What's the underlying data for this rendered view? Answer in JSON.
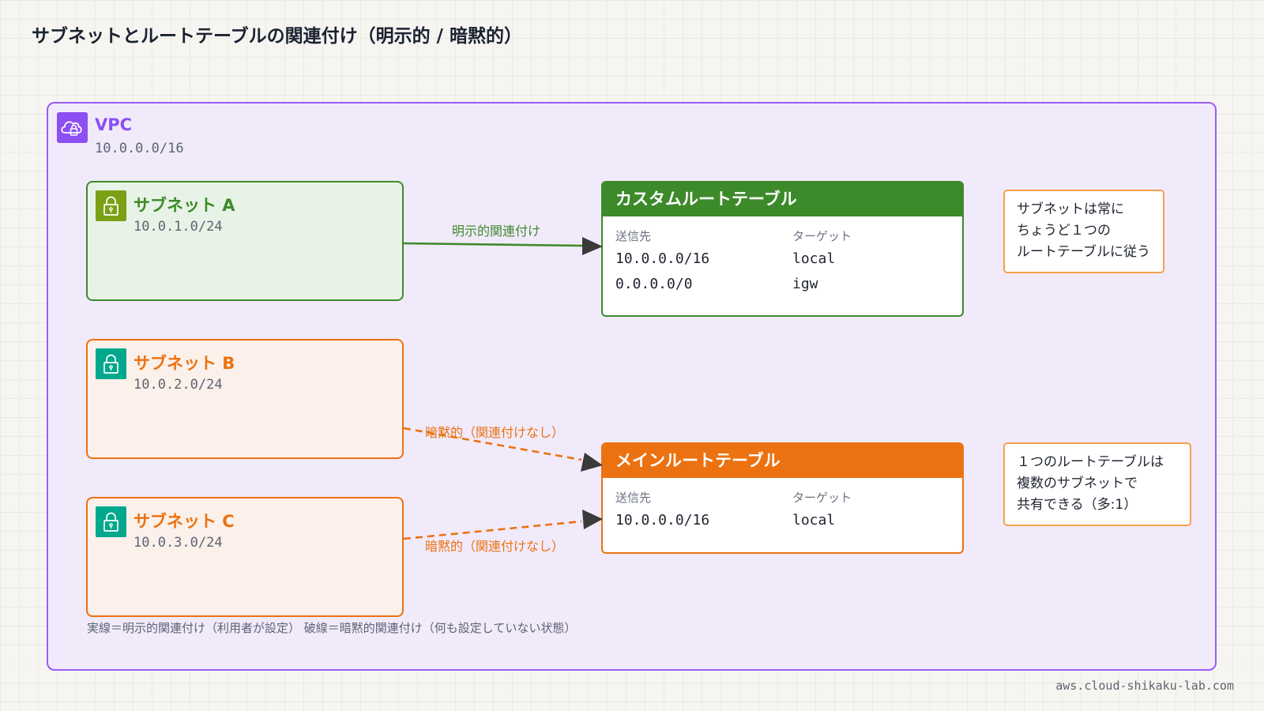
{
  "title": "サブネットとルートテーブルの関連付け（明示的 / 暗黙的）",
  "vpc": {
    "label": "VPC",
    "cidr": "10.0.0.0/16",
    "icon": "vpc-cloud-lock-icon",
    "color": "#8c4ff1"
  },
  "subnets": [
    {
      "name": "サブネット A",
      "cidr": "10.0.1.0/24",
      "icon": "lock-icon",
      "color": "#3d8a2a"
    },
    {
      "name": "サブネット B",
      "cidr": "10.0.2.0/24",
      "icon": "lock-icon",
      "color": "#ec7211"
    },
    {
      "name": "サブネット C",
      "cidr": "10.0.3.0/24",
      "icon": "lock-icon",
      "color": "#ec7211"
    }
  ],
  "route_tables": {
    "custom": {
      "title": "カスタムルートテーブル",
      "columns": [
        "送信先",
        "ターゲット"
      ],
      "routes": [
        {
          "dest": "10.0.0.0/16",
          "target": "local"
        },
        {
          "dest": "0.0.0.0/0",
          "target": "igw"
        }
      ]
    },
    "main": {
      "title": "メインルートテーブル",
      "columns": [
        "送信先",
        "ターゲット"
      ],
      "routes": [
        {
          "dest": "10.0.0.0/16",
          "target": "local"
        }
      ]
    }
  },
  "connections": {
    "explicit_label": "明示的関連付け",
    "implicit_label_b": "暗黙的（関連付けなし）",
    "implicit_label_c": "暗黙的（関連付けなし）"
  },
  "notes": [
    [
      "サブネットは常に",
      "ちょうど１つの",
      "ルートテーブルに従う"
    ],
    [
      "１つのルートテーブルは",
      "複数のサブネットで",
      "共有できる（多:1）"
    ]
  ],
  "legend": "実線＝明示的関連付け（利用者が設定） 破線＝暗黙的関連付け（何も設定していない状態）",
  "footer": "aws.cloud-shikaku-lab.com"
}
